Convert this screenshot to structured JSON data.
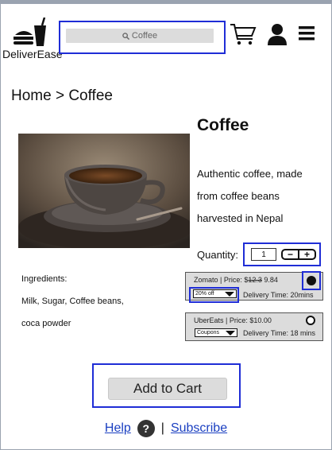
{
  "app": {
    "name": "DeliverEase"
  },
  "header": {
    "search_placeholder": "Coffee",
    "logo_icon": "drink-icon",
    "cart_icon": "cart-icon",
    "user_icon": "user-icon",
    "menu_icon": "hamburger-menu-icon"
  },
  "breadcrumb": "Home > Coffee",
  "product": {
    "title": "Coffee",
    "description": [
      "Authentic coffee, made",
      "from coffee beans",
      "harvested in Nepal"
    ],
    "quantity_label": "Quantity:",
    "quantity_value": "1",
    "minus": "−",
    "plus": "+"
  },
  "ingredients": {
    "label": "Ingredients:",
    "lines": [
      "Milk, Sugar, Coffee beans,",
      "coca powder"
    ]
  },
  "offers": [
    {
      "provider_prefix": "Zomato | Price: $",
      "old_price": "12.3",
      "new_price": "9.84",
      "dropdown_value": "20% off",
      "delivery": "Delivery Time: 20mins",
      "selected": true
    },
    {
      "provider_prefix": "UberEats | Price: $10.00",
      "old_price": "",
      "new_price": "",
      "dropdown_value": "Coupons",
      "delivery": "Delivery Time: 18 mins",
      "selected": false
    }
  ],
  "actions": {
    "add_to_cart": "Add to Cart"
  },
  "footer": {
    "help": "Help",
    "help_icon_glyph": "?",
    "separator": "|",
    "subscribe": "Subscribe"
  },
  "colors": {
    "highlight": "#1f2dd6",
    "link": "#1a3fc1",
    "button_bg": "#dcdcdc"
  }
}
